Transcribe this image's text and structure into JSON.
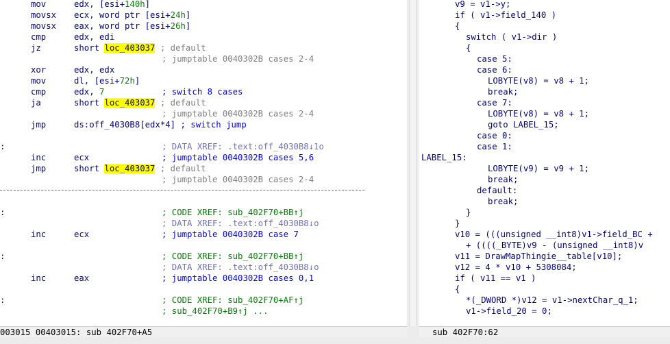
{
  "left_status": "003015 00403015: sub 402F70+A5",
  "right_status": "sub 402F70:62",
  "asm": [
    {
      "m": "mov",
      "o": "edx, [esi+",
      "n": "140h",
      "o2": "]"
    },
    {
      "m": "movsx",
      "o": "ecx, word ptr [esi+",
      "n": "24h",
      "o2": "]"
    },
    {
      "m": "movsx",
      "o": "eax, word ptr [esi+",
      "n": "26h",
      "o2": "]"
    },
    {
      "m": "cmp",
      "o": "edx, edi"
    },
    {
      "m": "jz",
      "o": "short ",
      "l": "loc_403037",
      "c": " ; default"
    },
    {
      "cg": "; jumptable 0040302B cases 2-4"
    },
    {
      "m": "xor",
      "o": "edx, edx"
    },
    {
      "m": "mov",
      "o": "dl, [esi+",
      "n": "72h",
      "o2": "]"
    },
    {
      "m": "cmp",
      "o": "edx, ",
      "n": "7",
      "cb": "; switch 8 cases"
    },
    {
      "m": "ja",
      "o": "short ",
      "l": "loc_403037",
      "c": " ; default"
    },
    {
      "cg": "; jumptable 0040302B cases 2-4"
    },
    {
      "m": "jmp",
      "o": "ds:off_4030B8[edx*4]",
      "cb": " ; switch jump"
    },
    {
      "xref": "; DATA XREF: .text:off_4030B8↓1o"
    },
    {
      "m": "inc",
      "o": "ecx",
      "cb": "; jumptable 0040302B cases 5,6"
    },
    {
      "m": "jmp",
      "o": "short ",
      "l": "loc_403037",
      "c": " ; default"
    },
    {
      "cg": "; jumptable 0040302B cases 2-4"
    },
    {
      "cgreen": "; CODE XREF: sub_402F70+BB↑j"
    },
    {
      "xref": "; DATA XREF: .text:off_4030B8↓o"
    },
    {
      "m": "inc",
      "o": "ecx",
      "cb": "; jumptable 0040302B case 7"
    },
    {
      "cgreen": "; CODE XREF: sub_402F70+BB↑j"
    },
    {
      "xref": "; DATA XREF: .text:off_4030B8↓o"
    },
    {
      "m": "inc",
      "o": "eax",
      "cb": "; jumptable 0040302B cases 0,1"
    },
    {
      "cgreen": "; CODE XREF: sub_402F70+AF↑j"
    },
    {
      "cgreen": "; sub_402F70+B9↑j ..."
    }
  ],
  "pseudo": [
    "v9 = v1->y;",
    "if ( v1->field_140 )",
    "{",
    "switch ( v1->dir )",
    "{",
    "case 5:",
    "case 6:",
    "LOBYTE(v8) = v8 + 1;",
    "break;",
    "case 7:",
    "LOBYTE(v8) = v8 + 1;",
    "goto LABEL_15;",
    "case 0:",
    "case 1:",
    "LABEL_15:",
    "LOBYTE(v9) = v9 + 1;",
    "break;",
    "default:",
    "break;",
    "}",
    "}",
    "v10 = (((unsigned __int8)v1->field_BC +",
    "+ ((((_BYTE)v9 - (unsigned __int8)v",
    "v11 = DrawMapThingie__table[v10];",
    "v12 = 4 * v10 + 5308084;",
    "if ( v11 == v1 )",
    "{",
    "*(_DWORD *)v12 = v1->nextChar_q_1;",
    "v1->field_20 = 0;"
  ]
}
